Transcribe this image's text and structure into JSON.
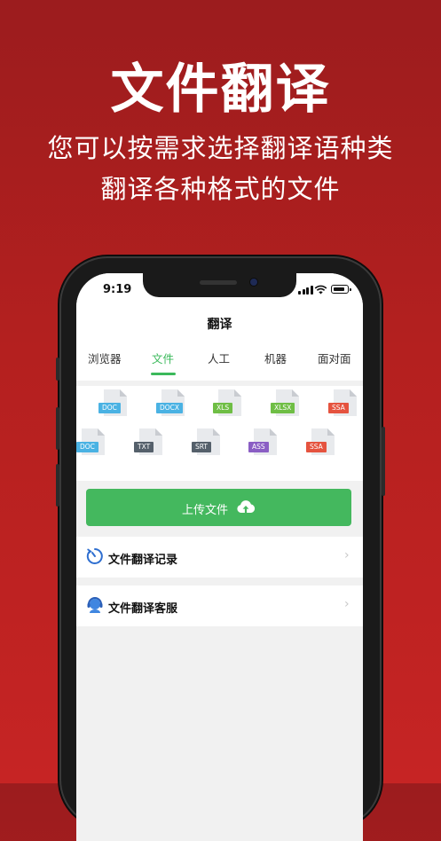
{
  "promo": {
    "headline": "文件翻译",
    "subline1": "您可以按需求选择翻译语种类",
    "subline2": "翻译各种格式的文件"
  },
  "status_bar": {
    "time": "9:19"
  },
  "nav": {
    "title": "翻译"
  },
  "tabs": [
    {
      "label": "浏览器"
    },
    {
      "label": "文件",
      "active": true
    },
    {
      "label": "人工"
    },
    {
      "label": "机器"
    },
    {
      "label": "面对面"
    }
  ],
  "file_types": {
    "row1": [
      {
        "label": "DOC",
        "color": "#4ab2e3"
      },
      {
        "label": "DOCX",
        "color": "#4ab2e3"
      },
      {
        "label": "XLS",
        "color": "#6fbe45"
      },
      {
        "label": "XLSX",
        "color": "#6fbe45"
      },
      {
        "label": "SSA",
        "color": "#e5533f"
      }
    ],
    "row2": [
      {
        "label": "DOC",
        "color": "#4ab2e3"
      },
      {
        "label": "TXT",
        "color": "#55606b"
      },
      {
        "label": "SRT",
        "color": "#55606b"
      },
      {
        "label": "ASS",
        "color": "#8a5ec4"
      },
      {
        "label": "SSA",
        "color": "#e5533f"
      }
    ]
  },
  "upload_button": {
    "label": "上传文件",
    "icon": "cloud-upload-icon",
    "color": "#44b85e"
  },
  "menu": [
    {
      "label": "文件翻译记录",
      "icon": "history-timer-icon"
    },
    {
      "label": "文件翻译客服",
      "icon": "customer-service-icon"
    }
  ],
  "colors": {
    "accent": "#3bb95b",
    "background": "#b4201f"
  }
}
